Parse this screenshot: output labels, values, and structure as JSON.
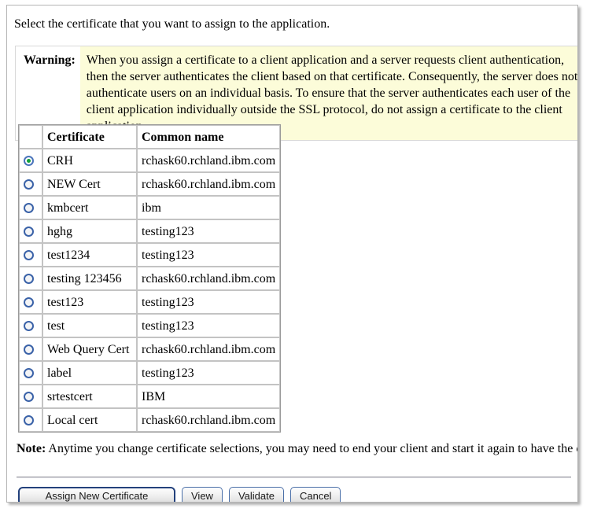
{
  "page": {
    "intro": "Select the certificate that you want to assign to the application."
  },
  "warning": {
    "label": "Warning:",
    "text": "When you assign a certificate to a client application and a server requests client authentication, then the server authenticates the client based on that certificate. Consequently, the server does not authenticate users on an individual basis. To ensure that the server authenticates each user of the client application individually outside the SSL protocol, do not assign a certificate to the client application."
  },
  "table": {
    "columns": {
      "select": "",
      "certificate": "Certificate",
      "common_name": "Common name"
    },
    "rows": [
      {
        "selected": true,
        "certificate": "CRH",
        "common_name": "rchask60.rchland.ibm.com"
      },
      {
        "selected": false,
        "certificate": "NEW Cert",
        "common_name": "rchask60.rchland.ibm.com"
      },
      {
        "selected": false,
        "certificate": "kmbcert",
        "common_name": "ibm"
      },
      {
        "selected": false,
        "certificate": "hghg",
        "common_name": "testing123"
      },
      {
        "selected": false,
        "certificate": "test1234",
        "common_name": "testing123"
      },
      {
        "selected": false,
        "certificate": "testing 123456",
        "common_name": "rchask60.rchland.ibm.com"
      },
      {
        "selected": false,
        "certificate": "test123",
        "common_name": "testing123"
      },
      {
        "selected": false,
        "certificate": "test",
        "common_name": "testing123"
      },
      {
        "selected": false,
        "certificate": "Web Query Cert",
        "common_name": "rchask60.rchland.ibm.com"
      },
      {
        "selected": false,
        "certificate": "label",
        "common_name": "testing123"
      },
      {
        "selected": false,
        "certificate": "srtestcert",
        "common_name": "IBM"
      },
      {
        "selected": false,
        "certificate": "Local cert",
        "common_name": "rchask60.rchland.ibm.com"
      }
    ]
  },
  "note": {
    "label": "Note:",
    "text": " Anytime you change certificate selections, you may need to end your client and start it again to have the change take effect."
  },
  "buttons": {
    "assign": "Assign New Certificate",
    "view": "View",
    "validate": "Validate",
    "cancel": "Cancel"
  },
  "colors": {
    "warning_background": "#fcfcd9",
    "radio_selected_dot": "#12a23a",
    "radio_border": "#3a62a8",
    "default_button_border": "#23417c"
  }
}
